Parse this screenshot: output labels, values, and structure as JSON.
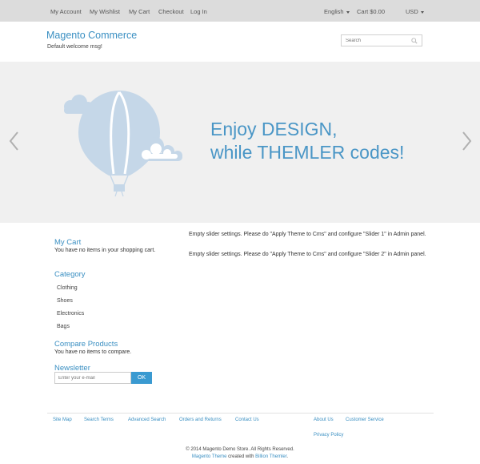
{
  "topbar": {
    "links": [
      "My Account",
      "My Wishlist",
      "My Cart",
      "Checkout",
      "Log In"
    ],
    "language": "English",
    "cart": "Cart $0.00",
    "currency": "USD"
  },
  "header": {
    "store_title": "Magento Commerce",
    "welcome": "Default welcome msg!",
    "search_placeholder": "Search"
  },
  "slider": {
    "headline_line1": "Enjoy DESIGN,",
    "headline_line2": "while THEMLER codes!"
  },
  "sidebar": {
    "cart_title": "My Cart",
    "cart_empty": "You have no items in your shopping cart.",
    "category_title": "Category",
    "categories": [
      "Clothing",
      "Shoes",
      "Electronics",
      "Bags"
    ],
    "compare_title": "Compare Products",
    "compare_empty": "You have no items to compare.",
    "newsletter_title": "Newsletter",
    "newsletter_placeholder": "Enter your e-mail",
    "newsletter_button": "OK"
  },
  "main": {
    "slider1_msg": "Empty slider settings. Please do \"Apply Theme to Cms\" and configure \"Slider 1\" in Admin panel.",
    "slider2_msg": "Empty slider settings. Please do \"Apply Theme to Cms\" and configure \"Slider 2\" in Admin panel."
  },
  "footer": {
    "links_left": [
      "Site Map",
      "Search Terms",
      "Advanced Search",
      "Orders and Returns",
      "Contact Us"
    ],
    "links_right": [
      "About Us",
      "Customer Service",
      "Privacy Policy"
    ],
    "copyright": "© 2014 Magento Demo Store. All Rights Reserved.",
    "credit_theme": "Magento Theme",
    "credit_mid": " created with ",
    "credit_tool": "Billion Themler",
    "credit_end": "."
  },
  "colors": {
    "accent": "#3a8fc2",
    "button": "#3a9ad1",
    "topbar_bg": "#dcdcdc",
    "slider_bg": "#f0f0f0",
    "balloon": "#c5d7e8"
  }
}
